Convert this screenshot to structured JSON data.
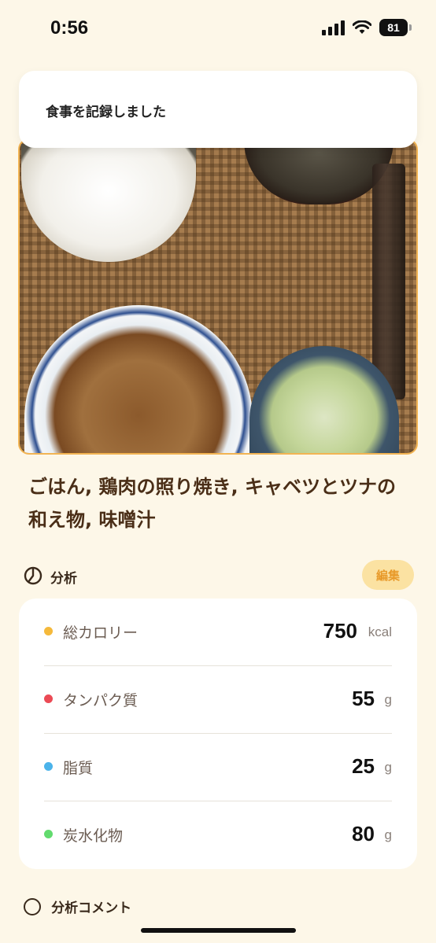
{
  "status_bar": {
    "time": "0:56",
    "battery": "81"
  },
  "toast": {
    "message": "食事を記録しました"
  },
  "meal": {
    "title": "ごはん, 鶏肉の照り焼き, キャベツとツナの和え物, 味噌汁"
  },
  "analysis": {
    "label": "分析",
    "edit_label": "編集",
    "icon": "pie-chart-icon"
  },
  "nutrition": [
    {
      "label": "総カロリー",
      "value": "750",
      "unit": "kcal",
      "color": "#F5B93B"
    },
    {
      "label": "タンパク質",
      "value": "55",
      "unit": "g",
      "color": "#EB4A55"
    },
    {
      "label": "脂質",
      "value": "25",
      "unit": "g",
      "color": "#4BB3EA"
    },
    {
      "label": "炭水化物",
      "value": "80",
      "unit": "g",
      "color": "#62DB6E"
    }
  ],
  "comment_section": {
    "label": "分析コメント"
  },
  "colors": {
    "background": "#FDF7E8",
    "accent": "#F2B453",
    "edit_button_bg": "#FBE2A2",
    "edit_button_text": "#E89A2A"
  }
}
